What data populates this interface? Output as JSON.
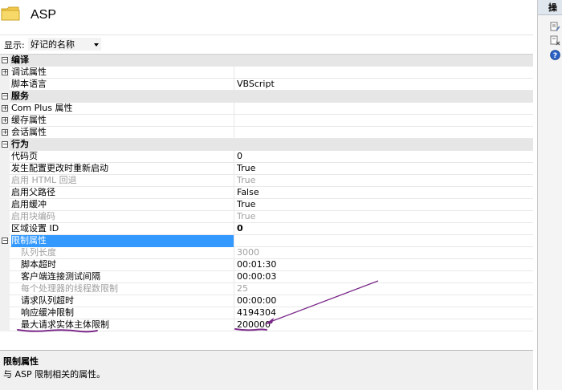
{
  "header": {
    "title": "ASP"
  },
  "toolbar": {
    "show_label": "显示:",
    "display_value": "好记的名称"
  },
  "grid": {
    "rows": [
      {
        "kind": "category",
        "toggle": "−",
        "name": "编译",
        "value": ""
      },
      {
        "kind": "item",
        "toggle": "+",
        "name": "调试属性",
        "value": ""
      },
      {
        "kind": "item",
        "toggle": "",
        "name": "脚本语言",
        "value": "VBScript"
      },
      {
        "kind": "category",
        "toggle": "−",
        "name": "服务",
        "value": ""
      },
      {
        "kind": "item",
        "toggle": "+",
        "name": "Com Plus 属性",
        "value": ""
      },
      {
        "kind": "item",
        "toggle": "+",
        "name": "缓存属性",
        "value": ""
      },
      {
        "kind": "item",
        "toggle": "+",
        "name": "会话属性",
        "value": ""
      },
      {
        "kind": "category",
        "toggle": "−",
        "name": "行为",
        "value": ""
      },
      {
        "kind": "item",
        "toggle": "",
        "name": "代码页",
        "value": "0"
      },
      {
        "kind": "item",
        "toggle": "",
        "name": "发生配置更改时重新启动",
        "value": "True"
      },
      {
        "kind": "disabled",
        "toggle": "",
        "name": "启用 HTML 回退",
        "value": "True"
      },
      {
        "kind": "item",
        "toggle": "",
        "name": "启用父路径",
        "value": "False"
      },
      {
        "kind": "item",
        "toggle": "",
        "name": "启用缓冲",
        "value": "True"
      },
      {
        "kind": "disabled",
        "toggle": "",
        "name": "启用块编码",
        "value": "True"
      },
      {
        "kind": "bold",
        "toggle": "",
        "name": "区域设置 ID",
        "value": "0"
      },
      {
        "kind": "selected",
        "toggle": "−",
        "name": "限制属性",
        "value": ""
      },
      {
        "kind": "subdisabled",
        "toggle": "",
        "name": "队列长度",
        "value": "3000"
      },
      {
        "kind": "sub",
        "toggle": "",
        "name": "脚本超时",
        "value": "00:01:30"
      },
      {
        "kind": "sub",
        "toggle": "",
        "name": "客户端连接测试间隔",
        "value": "00:00:03"
      },
      {
        "kind": "subdisabled",
        "toggle": "",
        "name": "每个处理器的线程数限制",
        "value": "25"
      },
      {
        "kind": "sub",
        "toggle": "",
        "name": "请求队列超时",
        "value": "00:00:00"
      },
      {
        "kind": "sub",
        "toggle": "",
        "name": "响应缓冲限制",
        "value": "4194304"
      },
      {
        "kind": "sub",
        "toggle": "",
        "name": "最大请求实体主体限制",
        "value": "200000"
      }
    ]
  },
  "description": {
    "title": "限制属性",
    "text": "与 ASP 限制相关的属性。"
  },
  "actions": {
    "header": "操作"
  },
  "colors": {
    "selection": "#3399ff",
    "annotation": "#7b2a8a",
    "category_bg": "#e6e6e6"
  }
}
